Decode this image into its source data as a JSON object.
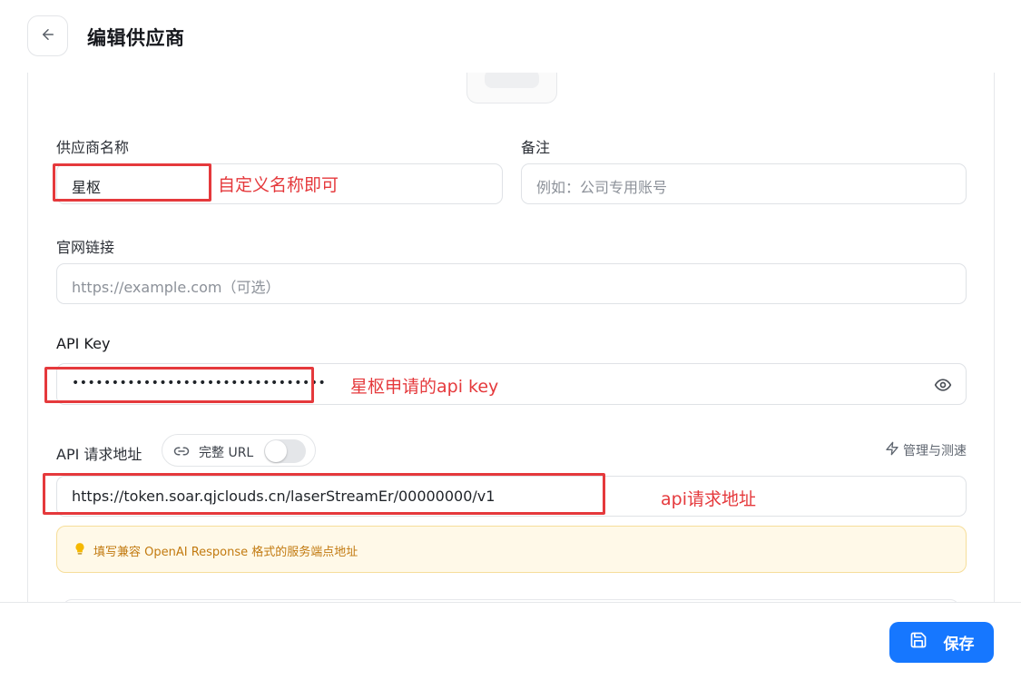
{
  "header": {
    "title": "编辑供应商"
  },
  "form": {
    "name": {
      "label": "供应商名称",
      "value": "星枢"
    },
    "note": {
      "label": "备注",
      "placeholder": "例如：公司专用账号"
    },
    "website": {
      "label": "官网链接",
      "placeholder": "https://example.com（可选）"
    },
    "api_key": {
      "label": "API Key",
      "value": "••••••••••••••••••••••••••••••••"
    },
    "api_url": {
      "label": "API 请求地址",
      "full_url_label": "完整 URL",
      "full_url_enabled": false,
      "manage_label": "管理与测速",
      "value": "https://token.soar.qjclouds.cn/laserStreamEr/00000000/v1",
      "hint": "填写兼容 OpenAI Response 格式的服务端点地址"
    }
  },
  "annotations": {
    "name": "自定义名称即可",
    "api_key": "星枢申请的api key",
    "api_url": "api请求地址"
  },
  "footer": {
    "save_label": "保存"
  },
  "colors": {
    "accent": "#1677ff",
    "annotation": "#e5393c",
    "hint_text": "#c27a10",
    "hint_bg": "#fff9e8"
  }
}
